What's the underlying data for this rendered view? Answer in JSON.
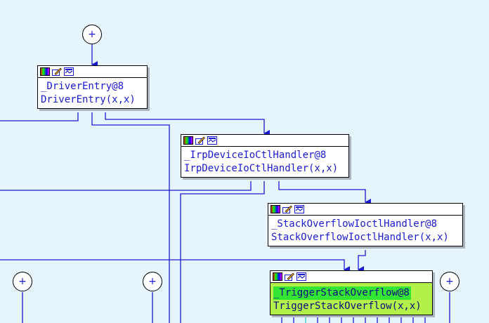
{
  "graph": {
    "nodes": [
      {
        "id": "driver-entry",
        "name": "_DriverEntry@8",
        "signature": "DriverEntry(x,x)"
      },
      {
        "id": "irp-handler",
        "name": "_IrpDeviceIoCtlHandler@8",
        "signature": "IrpDeviceIoCtlHandler(x,x)"
      },
      {
        "id": "stack-overflow-ioctl",
        "name": "_StackOverflowIoctlHandler@8",
        "signature": "StackOverflowIoctlHandler(x,x)"
      },
      {
        "id": "trigger-stack-overflow",
        "name": "_TriggerStackOverflow@8",
        "signature": "TriggerStackOverflow(x,x)",
        "selected": true
      }
    ],
    "expander_label": "+"
  },
  "colors": {
    "background": "#e6f4fc",
    "edge": "#1a1ad0",
    "edge_teal": "#33cccc",
    "node_text": "#1a1ad0",
    "selected_fill": "#b3f04a",
    "selected_highlight": "#33e633"
  },
  "icons": [
    "palette-icon",
    "edit-icon",
    "graph-view-icon"
  ]
}
